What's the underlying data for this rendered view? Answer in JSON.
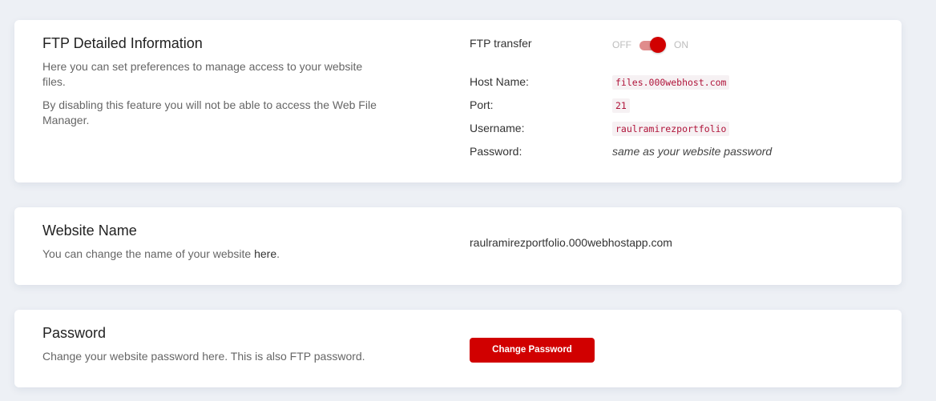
{
  "ftp": {
    "title": "FTP Detailed Information",
    "desc1": "Here you can set preferences to manage access to your website files.",
    "desc2": "By disabling this feature you will not be able to access the Web File Manager.",
    "transfer_label": "FTP transfer",
    "toggle_off": "OFF",
    "toggle_on": "ON",
    "toggle_state": "on",
    "host_label": "Host Name:",
    "host_value": "files.000webhost.com",
    "port_label": "Port:",
    "port_value": "21",
    "user_label": "Username:",
    "user_value": "raulramirezportfolio",
    "password_label": "Password:",
    "password_value": "same as your website password"
  },
  "website": {
    "title": "Website Name",
    "desc_prefix": "You can change the name of your website ",
    "desc_link": "here",
    "desc_suffix": ".",
    "value": "raulramirezportfolio.000webhostapp.com"
  },
  "password": {
    "title": "Password",
    "desc": "Change your website password here. This is also FTP password.",
    "button_label": "Change Password"
  },
  "colors": {
    "accent": "#d10000",
    "background": "#edf0f5",
    "code_text": "#b0143a"
  }
}
